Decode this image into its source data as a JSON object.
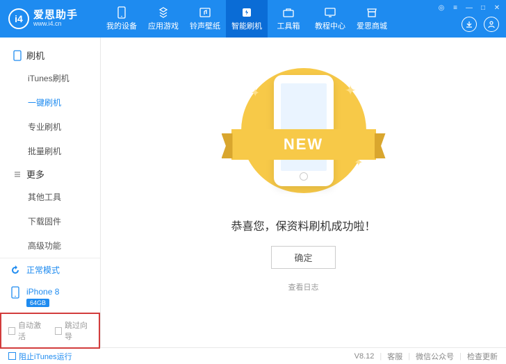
{
  "logo": {
    "badge": "i4",
    "title": "爱思助手",
    "url": "www.i4.cn"
  },
  "nav": [
    {
      "label": "我的设备",
      "icon": "device"
    },
    {
      "label": "应用游戏",
      "icon": "apps"
    },
    {
      "label": "铃声壁纸",
      "icon": "music"
    },
    {
      "label": "智能刷机",
      "icon": "flash",
      "active": true
    },
    {
      "label": "工具箱",
      "icon": "toolbox"
    },
    {
      "label": "教程中心",
      "icon": "tutorial"
    },
    {
      "label": "爱思商城",
      "icon": "shop"
    }
  ],
  "sidebar": {
    "groups": [
      {
        "title": "刷机",
        "items": [
          "iTunes刷机",
          "一键刷机",
          "专业刷机",
          "批量刷机"
        ],
        "activeIndex": 1
      },
      {
        "title": "更多",
        "items": [
          "其他工具",
          "下载固件",
          "高级功能"
        ],
        "activeIndex": -1
      }
    ],
    "status": "正常模式",
    "device": {
      "name": "iPhone 8",
      "storage": "64GB"
    },
    "checks": {
      "autoActivate": "自动激活",
      "skipWizard": "跳过向导"
    }
  },
  "main": {
    "ribbon": "NEW",
    "message": "恭喜您，保资料刷机成功啦！",
    "ok": "确定",
    "viewLog": "查看日志"
  },
  "footer": {
    "blockItunes": "阻止iTunes运行",
    "version": "V8.12",
    "support": "客服",
    "wechat": "微信公众号",
    "checkUpdate": "检查更新"
  }
}
